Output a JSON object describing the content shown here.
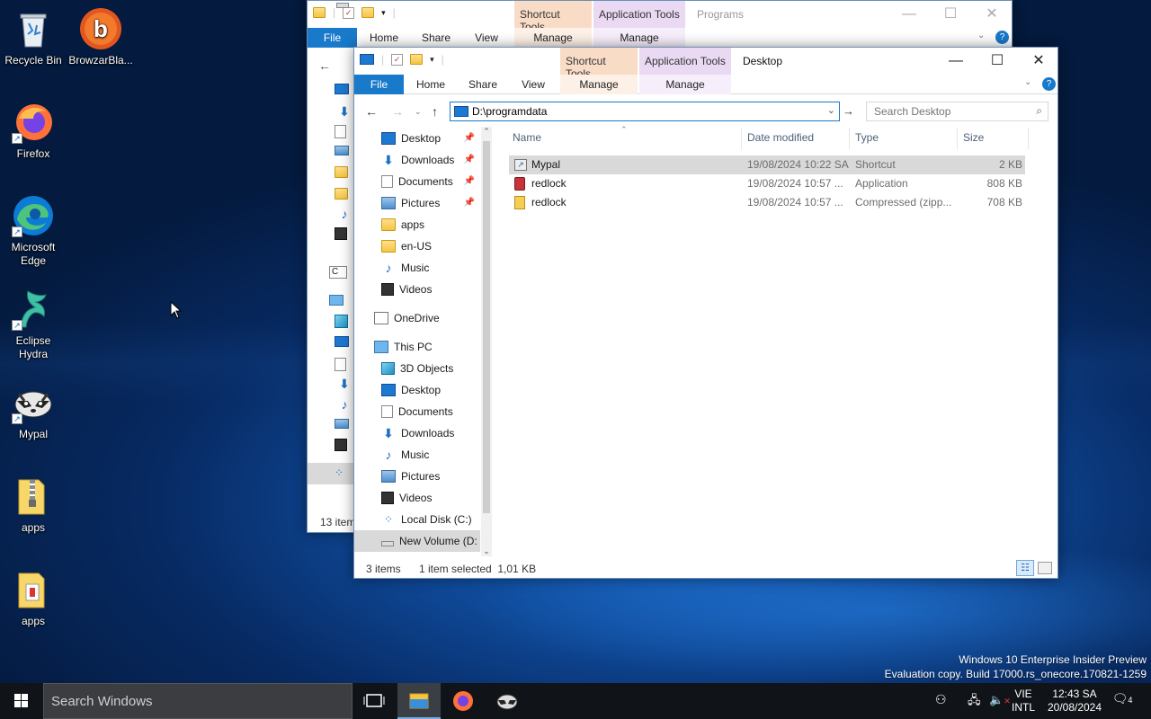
{
  "desktop": {
    "icons": [
      {
        "label": "Recycle Bin"
      },
      {
        "label": "BrowzarBla..."
      },
      {
        "label": "Firefox"
      },
      {
        "label": "Microsoft Edge"
      },
      {
        "label": "Eclipse Hydra"
      },
      {
        "label": "Mypal"
      },
      {
        "label": "apps"
      },
      {
        "label": "apps"
      }
    ]
  },
  "back_window": {
    "context_tabs": [
      "Shortcut Tools",
      "Application Tools"
    ],
    "title": "Programs",
    "ribbon": [
      "File",
      "Home",
      "Share",
      "View",
      "Manage",
      "Manage"
    ],
    "status_items": "13 item"
  },
  "front_window": {
    "context_tabs": [
      "Shortcut Tools",
      "Application Tools"
    ],
    "title": "Desktop",
    "ribbon": [
      "File",
      "Home",
      "Share",
      "View",
      "Manage",
      "Manage"
    ],
    "address": "D:\\programdata",
    "search_placeholder": "Search Desktop",
    "nav": {
      "quick_access": [
        {
          "label": "Desktop",
          "icon": "desktop-icon",
          "pinned": true
        },
        {
          "label": "Downloads",
          "icon": "download-icon",
          "pinned": true
        },
        {
          "label": "Documents",
          "icon": "documents-icon",
          "pinned": true
        },
        {
          "label": "Pictures",
          "icon": "pictures-icon",
          "pinned": true
        },
        {
          "label": "apps",
          "icon": "folder-icon",
          "pinned": false
        },
        {
          "label": "en-US",
          "icon": "folder-icon",
          "pinned": false
        },
        {
          "label": "Music",
          "icon": "music-icon",
          "pinned": false
        },
        {
          "label": "Videos",
          "icon": "videos-icon",
          "pinned": false
        }
      ],
      "onedrive": "OneDrive",
      "this_pc": "This PC",
      "this_pc_items": [
        {
          "label": "3D Objects",
          "icon": "3d-objects-icon"
        },
        {
          "label": "Desktop",
          "icon": "desktop-icon"
        },
        {
          "label": "Documents",
          "icon": "documents-icon"
        },
        {
          "label": "Downloads",
          "icon": "download-icon"
        },
        {
          "label": "Music",
          "icon": "music-icon"
        },
        {
          "label": "Pictures",
          "icon": "pictures-icon"
        },
        {
          "label": "Videos",
          "icon": "videos-icon"
        },
        {
          "label": "Local Disk (C:)",
          "icon": "local-disk-icon"
        },
        {
          "label": "New Volume (D:",
          "icon": "drive-icon"
        }
      ]
    },
    "columns": [
      "Name",
      "Date modified",
      "Type",
      "Size"
    ],
    "files": [
      {
        "name": "Mypal",
        "date": "19/08/2024 10:22 SA",
        "type": "Shortcut",
        "size": "2 KB",
        "selected": true,
        "icon": "shortcut-icon"
      },
      {
        "name": "redlock",
        "date": "19/08/2024 10:57 ...",
        "type": "Application",
        "size": "808 KB",
        "selected": false,
        "icon": "application-icon"
      },
      {
        "name": "redlock",
        "date": "19/08/2024 10:57 ...",
        "type": "Compressed (zipp...",
        "size": "708 KB",
        "selected": false,
        "icon": "zip-icon"
      }
    ],
    "status": {
      "count": "3 items",
      "selection": "1 item selected  1,01 KB"
    }
  },
  "watermark": {
    "line1": "Windows 10 Enterprise Insider Preview",
    "line2": "Evaluation copy. Build 17000.rs_onecore.170821-1259"
  },
  "taskbar": {
    "search_placeholder": "Search Windows",
    "lang_top": "VIE",
    "lang_bottom": "INTL",
    "time": "12:43 SA",
    "date": "20/08/2024",
    "notifications": "4"
  }
}
